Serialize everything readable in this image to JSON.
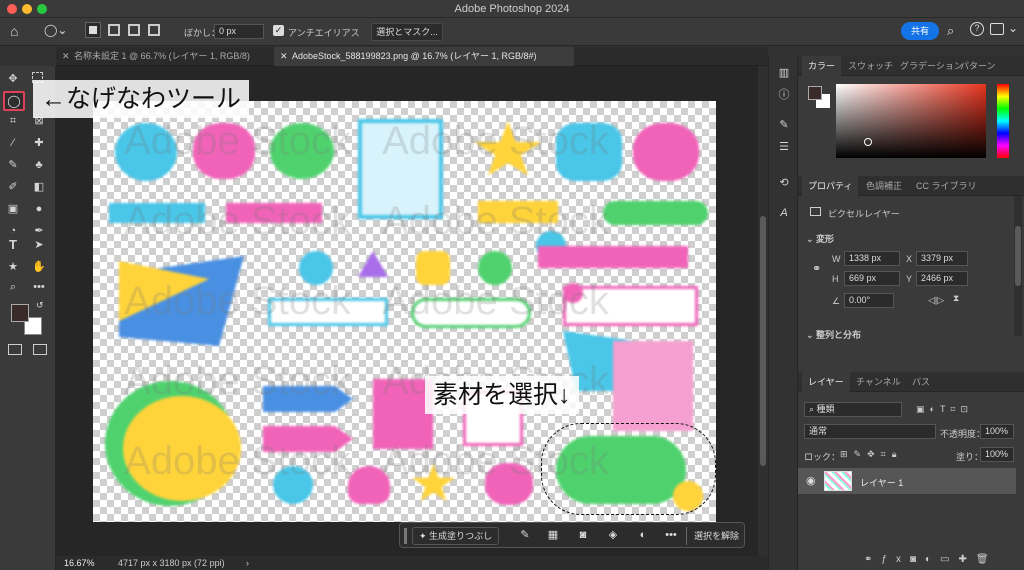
{
  "app": {
    "title": "Adobe Photoshop 2024"
  },
  "options": {
    "feather_label": "ぼかし：",
    "feather_value": "0 px",
    "antialias_label": "アンチエイリアス",
    "select_mask": "選択とマスク...",
    "share": "共有"
  },
  "tabs": [
    {
      "label": "名称未設定 1 @ 66.7% (レイヤー 1, RGB/8)"
    },
    {
      "label": "AdobeStock_588199823.png @ 16.7% (レイヤー 1, RGB/8#)"
    }
  ],
  "canvas": {
    "annotation_lasso": "←なげなわツール",
    "annotation_select": "素材を選択↓",
    "watermark": "Adobe Stock"
  },
  "status": {
    "zoom": "16.67%",
    "doc_size": "4717 px x 3180 px (72 ppi)"
  },
  "context_bar": {
    "generative_fill": "生成塗りつぶし",
    "deselect": "選択を解除"
  },
  "color_panel": {
    "tabs": [
      "カラー",
      "スウォッチ",
      "グラデーション",
      "パターン"
    ]
  },
  "properties": {
    "tabs": [
      "プロパティ",
      "色調補正",
      "CC ライブラリ"
    ],
    "layer_type": "ピクセルレイヤー",
    "transform_header": "変形",
    "w_label": "W",
    "w_value": "1338 px",
    "x_label": "X",
    "x_value": "3379 px",
    "h_label": "H",
    "h_value": "669 px",
    "y_label": "Y",
    "y_value": "2466 px",
    "angle_value": "0.00°",
    "align_header": "整列と分布"
  },
  "layers_panel": {
    "tabs": [
      "レイヤー",
      "チャンネル",
      "パス"
    ],
    "filter_label": "種類",
    "blend_mode": "通常",
    "opacity_label": "不透明度：",
    "opacity_value": "100%",
    "lock_label": "ロック：",
    "fill_label": "塗り：",
    "fill_value": "100%",
    "layers": [
      {
        "name": "レイヤー 1"
      }
    ]
  },
  "colors": {
    "accent": "#1473e6",
    "highlight": "#e0415a",
    "fg_swatch": "#3a2a2a",
    "bg_swatch": "#ffffff"
  },
  "icons": [
    "home-icon",
    "lasso-icon",
    "search-icon",
    "help-icon",
    "move-icon",
    "marquee-icon",
    "crop-icon",
    "brush-icon",
    "type-icon",
    "hand-icon",
    "zoom-icon",
    "eye-icon",
    "lock-icon",
    "trash-icon"
  ]
}
